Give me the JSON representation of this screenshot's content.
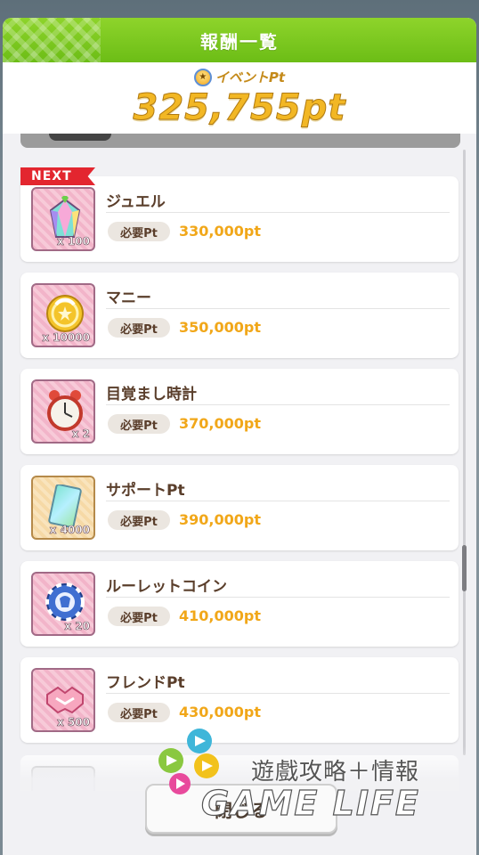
{
  "modal": {
    "title": "報酬一覧"
  },
  "points": {
    "label": "イベントPt",
    "value": "325,755pt"
  },
  "next_badge": "NEXT",
  "rewards": [
    {
      "name": "ジュエル",
      "qty": "x 100",
      "req_label": "必要Pt",
      "req_value": "330,000pt",
      "icon": "jewel-icon"
    },
    {
      "name": "マニー",
      "qty": "x 10000",
      "req_label": "必要Pt",
      "req_value": "350,000pt",
      "icon": "money-icon"
    },
    {
      "name": "目覚まし時計",
      "qty": "x 2",
      "req_label": "必要Pt",
      "req_value": "370,000pt",
      "icon": "alarm-clock-icon"
    },
    {
      "name": "サポートPt",
      "qty": "x 4000",
      "req_label": "必要Pt",
      "req_value": "390,000pt",
      "icon": "support-card-icon"
    },
    {
      "name": "ルーレットコイン",
      "qty": "x 20",
      "req_label": "必要Pt",
      "req_value": "410,000pt",
      "icon": "roulette-coin-icon"
    },
    {
      "name": "フレンドPt",
      "qty": "x 500",
      "req_label": "必要Pt",
      "req_value": "430,000pt",
      "icon": "handshake-icon"
    }
  ],
  "close_button": "閉じる",
  "watermark": {
    "cn_text": "遊戲攻略＋情報",
    "en_text": "GAME LIFE"
  },
  "colors": {
    "header_green": "#7cc820",
    "points_gold": "#f2b724",
    "req_orange": "#f1a719",
    "name_brown": "#5a3e2b",
    "next_red": "#e3262f"
  }
}
